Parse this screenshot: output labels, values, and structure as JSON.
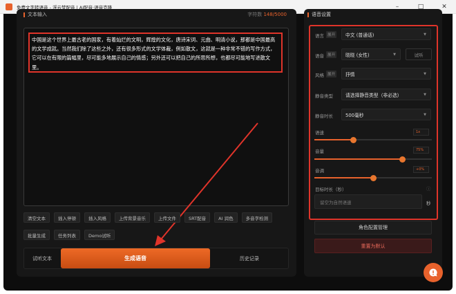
{
  "window": {
    "title": "免费文字转语音 - 浮云梦配音 | AI配音·语音克隆",
    "minimize_glyph": "–",
    "maximize_glyph": "□",
    "close_glyph": "✕"
  },
  "left_panel": {
    "title": "文本输入",
    "word_count_label": "字符数",
    "word_count_value": "148/5000",
    "text": "中国是这个世界上最古老的国家，有着灿烂的文明，辉煌的文化，唐诗宋词、元曲、明清小说，那都是中国最高的文学成就。当然我们除了这些之外，还有很多形式的文学体裁，例如散文，这就是一种非常不错的写作方式，它可以在有限的篇幅里，尽可能多地展示自己的情感；另外还可以把自己的所思所想，也都尽可能地写进散文里。",
    "tool_row1": [
      "清空文本",
      "插入停顿",
      "插入风格",
      "上传背景音乐",
      "上传文件",
      "SRT配音",
      "AI 润色",
      "多音字检测"
    ],
    "tool_row2": [
      "批量生成",
      "任务列表",
      "Demo试听"
    ],
    "listen_btn": "试听文本",
    "generate_btn": "生成语音",
    "history_btn": "历史记录"
  },
  "right_panel": {
    "title": "语音设置",
    "expand_label": "展开",
    "language": {
      "label": "语言",
      "value": "中文 (普通话)"
    },
    "voice": {
      "label": "语音",
      "value": "晓晓 (女性)",
      "audition": "试听"
    },
    "style": {
      "label": "风格",
      "value": "抒情"
    },
    "silence_type": {
      "label": "静音类型",
      "value": "请选择静音类型（非必选）"
    },
    "silence_duration": {
      "label": "静音时长",
      "value": "500毫秒"
    },
    "rate": {
      "label": "语速",
      "value": "1x",
      "level": 0.33
    },
    "volume": {
      "label": "音量",
      "value": "75%",
      "level": 0.75
    },
    "pitch": {
      "label": "音调",
      "value": "+0%",
      "level": 0.5
    },
    "target_duration": {
      "label": "目标时长（秒）",
      "placeholder": "留空为自然语速",
      "unit": "秒",
      "info_glyph": "ⓘ"
    },
    "manage_btn": "角色配置管理",
    "reset_btn": "重置为默认"
  },
  "icons": {
    "app": "app-logo-icon",
    "caret": "caret-down-icon",
    "fab": "chat-help-icon"
  },
  "colors": {
    "accent": "#e8622c",
    "highlight_box": "#e0342a",
    "background": "#0d0d0d"
  }
}
